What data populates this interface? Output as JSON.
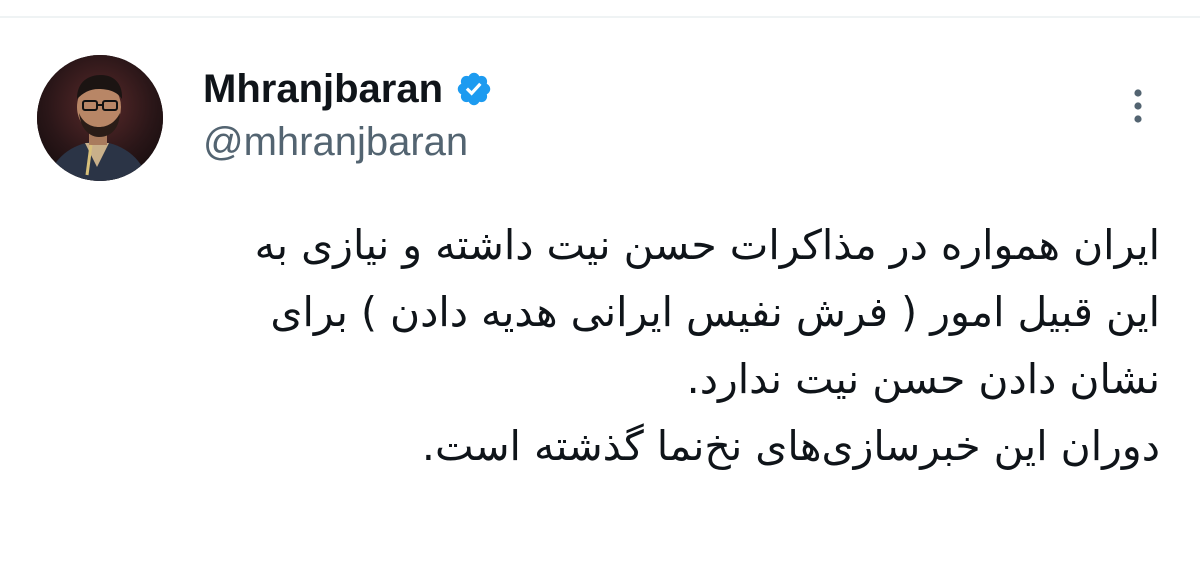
{
  "tweet": {
    "author": {
      "display_name": "Mhranjbaran",
      "username": "@mhranjbaran",
      "verified": true,
      "badge_color": "#1d9bf0"
    },
    "text_lines": [
      "ایران همواره در مذاکرات حسن نیت داشته و نیازی به",
      "این قبیل امور ( فرش نفیس ایرانی هدیه دادن ) برای",
      "نشان دادن حسن نیت ندارد.",
      "دوران این خبرسازی‌های نخ‌نما گذشته است."
    ],
    "icons": {
      "avatar": "avatar-photo",
      "verified": "verified-badge-icon",
      "more": "more-vertical-icon"
    }
  }
}
